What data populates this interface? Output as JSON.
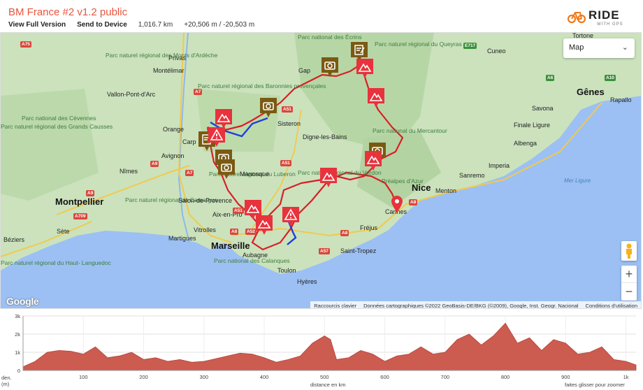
{
  "header": {
    "title": "BM France #2 v1.2 public",
    "view_full": "View Full Version",
    "send_device": "Send to Device",
    "distance": "1,016.7 km",
    "elevation": "+20,506 m / -20,503 m"
  },
  "logo": {
    "ride": "RIDE",
    "gps": "WITH GPS"
  },
  "map": {
    "type_selected": "Map",
    "google": "Google",
    "attribution": [
      "Raccourcis clavier",
      "Données cartographiques ©2022 GeoBasis-DE/BKG (©2009), Google, Inst. Geogr. Nacional",
      "Conditions d'utilisation"
    ],
    "zoom_in": "+",
    "zoom_out": "−",
    "labels": {
      "parc_ecrins": "Parc national\ndes Écrins",
      "parc_queyras": "Parc naturel\nrégional du\nQueyras",
      "parc_monts_ardeche": "Parc naturel\nrégional des\nMonts\nd'Ardèche",
      "parc_baronnies": "Parc naturel\nrégional des\nBaronnies\nprovençales",
      "parc_cevennes": "Parc national\ndes Cévennes",
      "parc_grands_causses": "Parc\nnaturel\nrégional des\nGrands\nCausses",
      "parc_mercantour": "Parc national\ndu Mercantour",
      "parc_verdon": "Parc naturel\nrégional du Verdon",
      "parc_luberon": "Parc naturel\nrégional du\nLuberon",
      "parc_prealpes": "Préalpes\nd'Azur",
      "parc_camargue": "Parc naturel\nrégional de\nCamargue",
      "parc_calanques": "Parc national\ndes Calanques",
      "parc_haut_languedoc": "Parc\nnaturel\nrégional\ndu Haut-\nLanguedoc",
      "gap": "Gap",
      "montelimar": "Montélimar",
      "privas": "Privas",
      "vallon": "Vallon-Pont-d'Arc",
      "orange": "Orange",
      "carpentras": "Carp",
      "avignon": "Avignon",
      "nimes": "Nîmes",
      "montpellier": "Montpellier",
      "sete": "Sète",
      "beziers": "Béziers",
      "sisteron": "Sisteron",
      "digne": "Digne-les-Bains",
      "manosque": "Manosque",
      "salon": "Salon-de-Provence",
      "aix": "Aix-en-Pro",
      "vitrolles": "Vitrolles",
      "martigues": "Martigues",
      "marseille": "Marseille",
      "aubagne": "Aubagne",
      "toulon": "Toulon",
      "hyeres": "Hyères",
      "saint_tropez": "Saint-Tropez",
      "frejus": "Fréjus",
      "cannes": "Cannes",
      "nice": "Nice",
      "menton": "Menton",
      "sanremo": "Sanremo",
      "imperia": "Imperia",
      "albenga": "Albenga",
      "finale": "Finale Ligure",
      "savona": "Savona",
      "genes": "Gênes",
      "rapallo": "Rapallo",
      "cuneo": "Cuneo",
      "tortone": "Tortone",
      "mer_ligure": "Mer Ligure"
    },
    "roads": [
      "A75",
      "A7",
      "A9",
      "A9",
      "A709",
      "A51",
      "A51",
      "A8",
      "A8",
      "A57",
      "A52",
      "A8",
      "E717",
      "A6",
      "A10",
      "A7",
      "A51"
    ]
  },
  "elevation_chart": {
    "chart_data": {
      "type": "area",
      "ylabel": "den.\n(m)",
      "xlabel": "distance en km",
      "hint": "faites glisser pour zoomer",
      "y_ticks": [
        "3k",
        "2k",
        "1k",
        "0"
      ],
      "x_ticks": [
        "100",
        "200",
        "300",
        "400",
        "500",
        "600",
        "700",
        "800",
        "900",
        "1k"
      ],
      "xlim": [
        0,
        1016.7
      ],
      "ylim": [
        0,
        3000
      ],
      "x": [
        0,
        20,
        40,
        60,
        80,
        100,
        120,
        140,
        160,
        180,
        200,
        220,
        240,
        260,
        280,
        300,
        320,
        340,
        360,
        380,
        400,
        420,
        440,
        460,
        480,
        500,
        510,
        520,
        540,
        560,
        580,
        600,
        620,
        640,
        660,
        680,
        700,
        720,
        740,
        760,
        780,
        800,
        820,
        840,
        860,
        880,
        900,
        920,
        940,
        960,
        980,
        1000,
        1016.7
      ],
      "y": [
        200,
        500,
        1000,
        1100,
        1050,
        900,
        1300,
        700,
        800,
        1000,
        600,
        700,
        500,
        600,
        450,
        500,
        650,
        800,
        950,
        900,
        700,
        450,
        600,
        800,
        1500,
        1900,
        1700,
        600,
        700,
        1100,
        900,
        500,
        800,
        900,
        1300,
        900,
        1000,
        1700,
        2000,
        1400,
        1900,
        2600,
        1500,
        1800,
        1100,
        1700,
        1500,
        900,
        1000,
        1300,
        600,
        500,
        300
      ]
    }
  }
}
